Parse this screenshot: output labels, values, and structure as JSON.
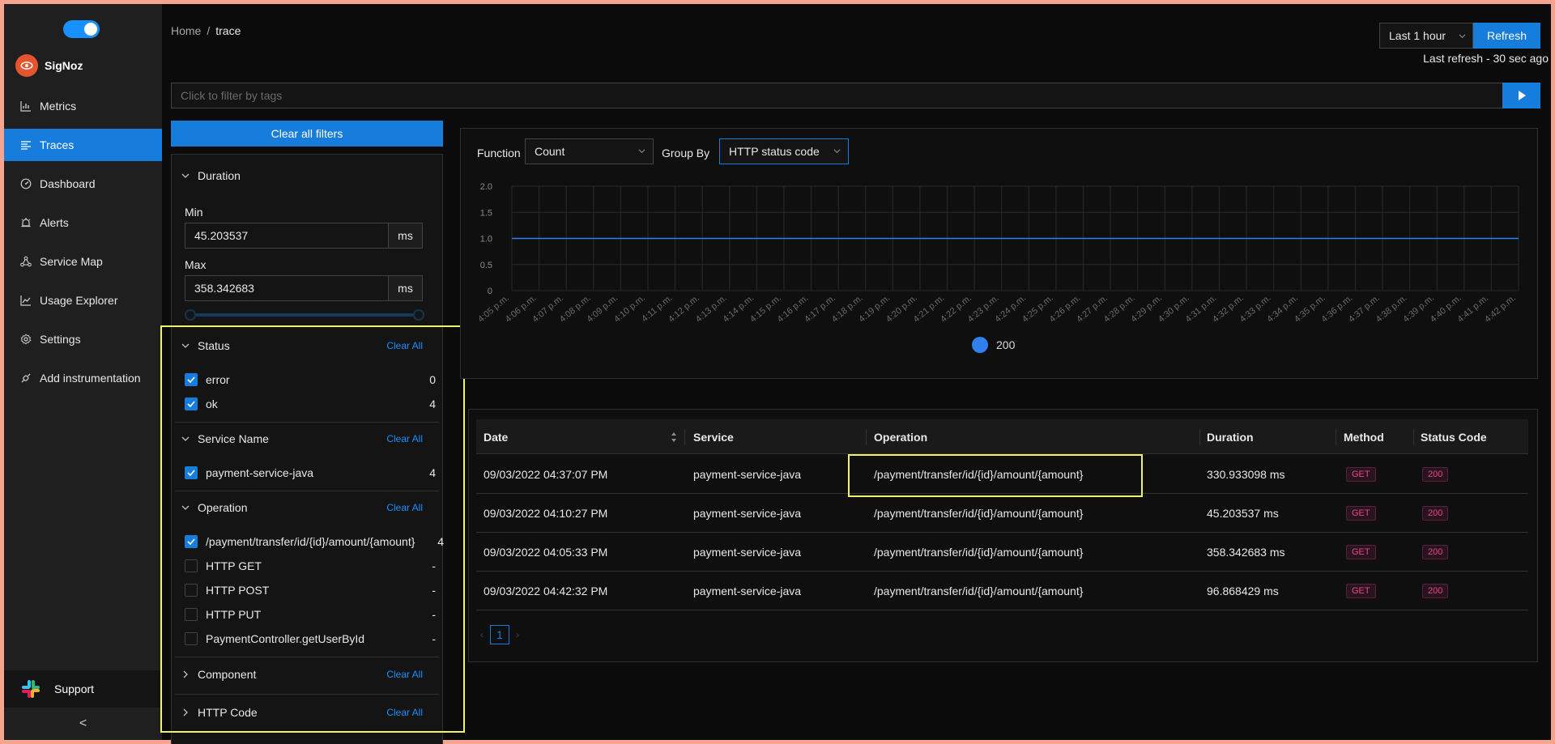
{
  "app": {
    "brand": "SigNoz",
    "theme_toggle_on": true
  },
  "sidebar": {
    "items": [
      {
        "label": "Metrics",
        "icon": "bar-chart-icon",
        "active": false
      },
      {
        "label": "Traces",
        "icon": "align-left-icon",
        "active": true
      },
      {
        "label": "Dashboard",
        "icon": "dashboard-icon",
        "active": false
      },
      {
        "label": "Alerts",
        "icon": "alarm-icon",
        "active": false
      },
      {
        "label": "Service Map",
        "icon": "deployment-unit-icon",
        "active": false
      },
      {
        "label": "Usage Explorer",
        "icon": "line-chart-icon",
        "active": false
      },
      {
        "label": "Settings",
        "icon": "settings-icon",
        "active": false
      },
      {
        "label": "Add instrumentation",
        "icon": "api-icon",
        "active": false
      }
    ],
    "support_label": "Support",
    "collapse_icon": "<"
  },
  "header": {
    "breadcrumb_home": "Home",
    "breadcrumb_sep": "/",
    "breadcrumb_current": "trace",
    "time_range": "Last 1 hour",
    "refresh_label": "Refresh",
    "last_refresh": "Last refresh - 30 sec ago"
  },
  "search": {
    "placeholder": "Click to filter by tags"
  },
  "filters": {
    "clear_all_button": "Clear all filters",
    "clear_all_link": "Clear All",
    "duration": {
      "title": "Duration",
      "min_label": "Min",
      "min_value": "45.203537",
      "max_label": "Max",
      "max_value": "358.342683",
      "unit": "ms"
    },
    "status": {
      "title": "Status",
      "options": [
        {
          "label": "error",
          "count": "0",
          "checked": true
        },
        {
          "label": "ok",
          "count": "4",
          "checked": true
        }
      ]
    },
    "service_name": {
      "title": "Service Name",
      "options": [
        {
          "label": "payment-service-java",
          "count": "4",
          "checked": true
        }
      ]
    },
    "operation": {
      "title": "Operation",
      "options": [
        {
          "label": "/payment/transfer/id/{id}/amount/{amount}",
          "count": "4",
          "checked": true
        },
        {
          "label": "HTTP GET",
          "count": "-",
          "checked": false
        },
        {
          "label": "HTTP POST",
          "count": "-",
          "checked": false
        },
        {
          "label": "HTTP PUT",
          "count": "-",
          "checked": false
        },
        {
          "label": "PaymentController.getUserById",
          "count": "-",
          "checked": false
        }
      ]
    },
    "component": {
      "title": "Component"
    },
    "http_code": {
      "title": "HTTP Code"
    }
  },
  "query": {
    "function_label": "Function",
    "function_value": "Count",
    "group_by_label": "Group By",
    "group_by_value": "HTTP status code"
  },
  "chart_data": {
    "type": "line",
    "x": [
      "4:05 p.m.",
      "4:06 p.m.",
      "4:07 p.m.",
      "4:08 p.m.",
      "4:09 p.m.",
      "4:10 p.m.",
      "4:11 p.m.",
      "4:12 p.m.",
      "4:13 p.m.",
      "4:14 p.m.",
      "4:15 p.m.",
      "4:16 p.m.",
      "4:17 p.m.",
      "4:18 p.m.",
      "4:19 p.m.",
      "4:20 p.m.",
      "4:21 p.m.",
      "4:22 p.m.",
      "4:23 p.m.",
      "4:24 p.m.",
      "4:25 p.m.",
      "4:26 p.m.",
      "4:27 p.m.",
      "4:28 p.m.",
      "4:29 p.m.",
      "4:30 p.m.",
      "4:31 p.m.",
      "4:32 p.m.",
      "4:33 p.m.",
      "4:34 p.m.",
      "4:35 p.m.",
      "4:36 p.m.",
      "4:37 p.m.",
      "4:38 p.m.",
      "4:39 p.m.",
      "4:40 p.m.",
      "4:41 p.m.",
      "4:42 p.m."
    ],
    "series": [
      {
        "name": "200",
        "color": "#2f80ed",
        "values": [
          1,
          1,
          1,
          1,
          1,
          1,
          1,
          1,
          1,
          1,
          1,
          1,
          1,
          1,
          1,
          1,
          1,
          1,
          1,
          1,
          1,
          1,
          1,
          1,
          1,
          1,
          1,
          1,
          1,
          1,
          1,
          1,
          1,
          1,
          1,
          1,
          1,
          1
        ]
      }
    ],
    "y_ticks": [
      "2.0",
      "1.5",
      "1.0",
      "0.5",
      "0"
    ],
    "ylim": [
      0,
      2
    ],
    "grid": true,
    "legend": "bottom-center"
  },
  "table": {
    "columns": [
      "Date",
      "Service",
      "Operation",
      "Duration",
      "Method",
      "Status Code"
    ],
    "rows": [
      {
        "date": "09/03/2022 04:37:07 PM",
        "service": "payment-service-java",
        "operation": "/payment/transfer/id/{id}/amount/{amount}",
        "duration": "330.933098 ms",
        "method": "GET",
        "status": "200"
      },
      {
        "date": "09/03/2022 04:10:27 PM",
        "service": "payment-service-java",
        "operation": "/payment/transfer/id/{id}/amount/{amount}",
        "duration": "45.203537 ms",
        "method": "GET",
        "status": "200"
      },
      {
        "date": "09/03/2022 04:05:33 PM",
        "service": "payment-service-java",
        "operation": "/payment/transfer/id/{id}/amount/{amount}",
        "duration": "358.342683 ms",
        "method": "GET",
        "status": "200"
      },
      {
        "date": "09/03/2022 04:42:32 PM",
        "service": "payment-service-java",
        "operation": "/payment/transfer/id/{id}/amount/{amount}",
        "duration": "96.868429 ms",
        "method": "GET",
        "status": "200"
      }
    ],
    "page": "1"
  }
}
